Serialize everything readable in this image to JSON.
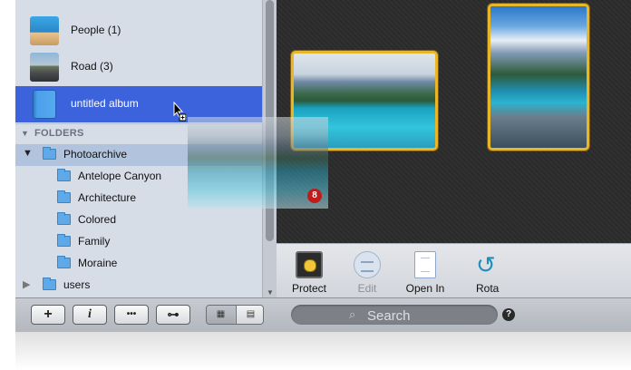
{
  "albums": [
    {
      "label": "People (1)",
      "thumb": "people"
    },
    {
      "label": "Road (3)",
      "thumb": "road"
    },
    {
      "label": "untitled album",
      "thumb": "album",
      "selected": true
    }
  ],
  "folders": {
    "header": "FOLDERS",
    "items": [
      {
        "label": "Photoarchive",
        "level": 0,
        "expanded": true,
        "highlighted": true
      },
      {
        "label": "Antelope Canyon",
        "level": 1
      },
      {
        "label": "Architecture",
        "level": 1
      },
      {
        "label": "Colored",
        "level": 1
      },
      {
        "label": "Family",
        "level": 1
      },
      {
        "label": "Moraine",
        "level": 1
      },
      {
        "label": "users",
        "level": 0,
        "expanded": false
      }
    ]
  },
  "drag": {
    "badge_count": "8"
  },
  "toolbar": {
    "protect": "Protect",
    "edit": "Edit",
    "open_in": "Open In",
    "rotate": "Rota"
  },
  "bottom": {
    "add": "+",
    "info": "i",
    "more": "•••",
    "key": "⊶",
    "search_placeholder": "Search",
    "help": "?"
  },
  "colors": {
    "selection": "#3c63dc",
    "photo_border": "#e9b62a",
    "badge": "#c01b1b"
  }
}
